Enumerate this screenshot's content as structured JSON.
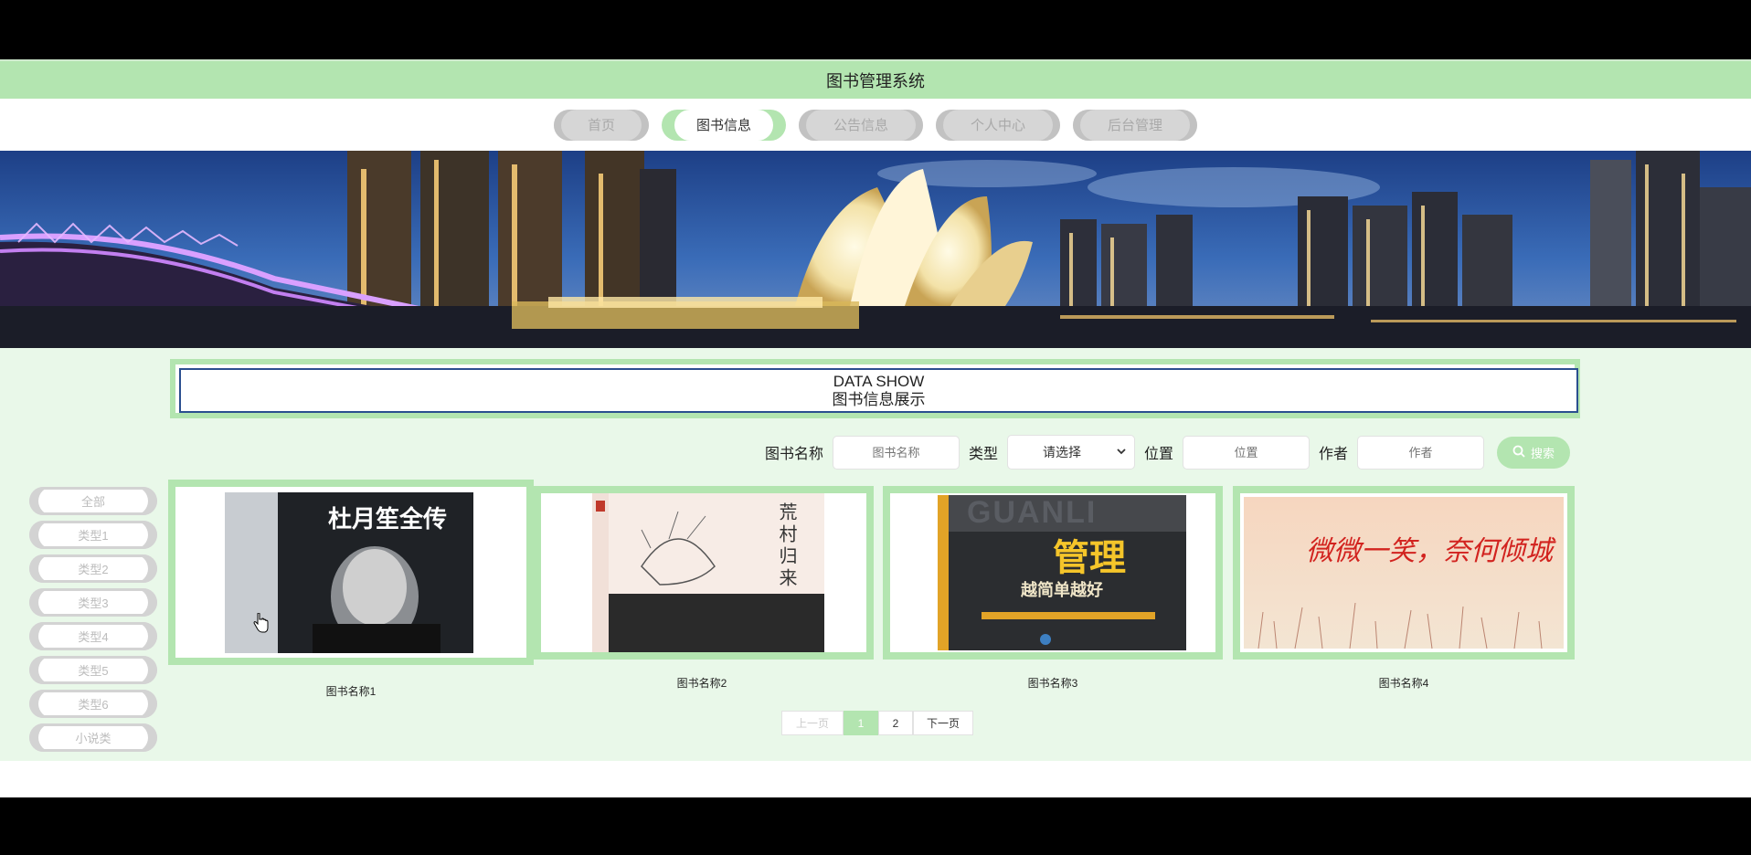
{
  "header": {
    "title": "图书管理系统"
  },
  "nav": {
    "items": [
      {
        "label": "首页",
        "active": false
      },
      {
        "label": "图书信息",
        "active": true
      },
      {
        "label": "公告信息",
        "active": false
      },
      {
        "label": "个人中心",
        "active": false
      },
      {
        "label": "后台管理",
        "active": false
      }
    ]
  },
  "section": {
    "title_en": "DATA SHOW",
    "title_cn": "图书信息展示"
  },
  "search": {
    "name_label": "图书名称",
    "name_placeholder": "图书名称",
    "type_label": "类型",
    "type_value": "请选择",
    "location_label": "位置",
    "location_placeholder": "位置",
    "author_label": "作者",
    "author_placeholder": "作者",
    "button_label": "搜索"
  },
  "sidebar": {
    "items": [
      "全部",
      "类型1",
      "类型2",
      "类型3",
      "类型4",
      "类型5",
      "类型6",
      "小说类"
    ]
  },
  "books": [
    {
      "name": "图书名称1",
      "cover_title": "杜月笙全传"
    },
    {
      "name": "图书名称2",
      "cover_title": "荒村归来"
    },
    {
      "name": "图书名称3",
      "cover_title": "管理",
      "cover_subtitle": "越简单越好",
      "cover_bg_text": "GUANLI"
    },
    {
      "name": "图书名称4",
      "cover_title": "微微一笑，奈何倾城"
    }
  ],
  "pagination": {
    "prev": "上一页",
    "pages": [
      "1",
      "2"
    ],
    "current": "1",
    "next": "下一页"
  },
  "colors": {
    "accent": "#b3e5b0",
    "content_bg": "#e9f8e9",
    "border_blue": "#2a4f8f"
  }
}
